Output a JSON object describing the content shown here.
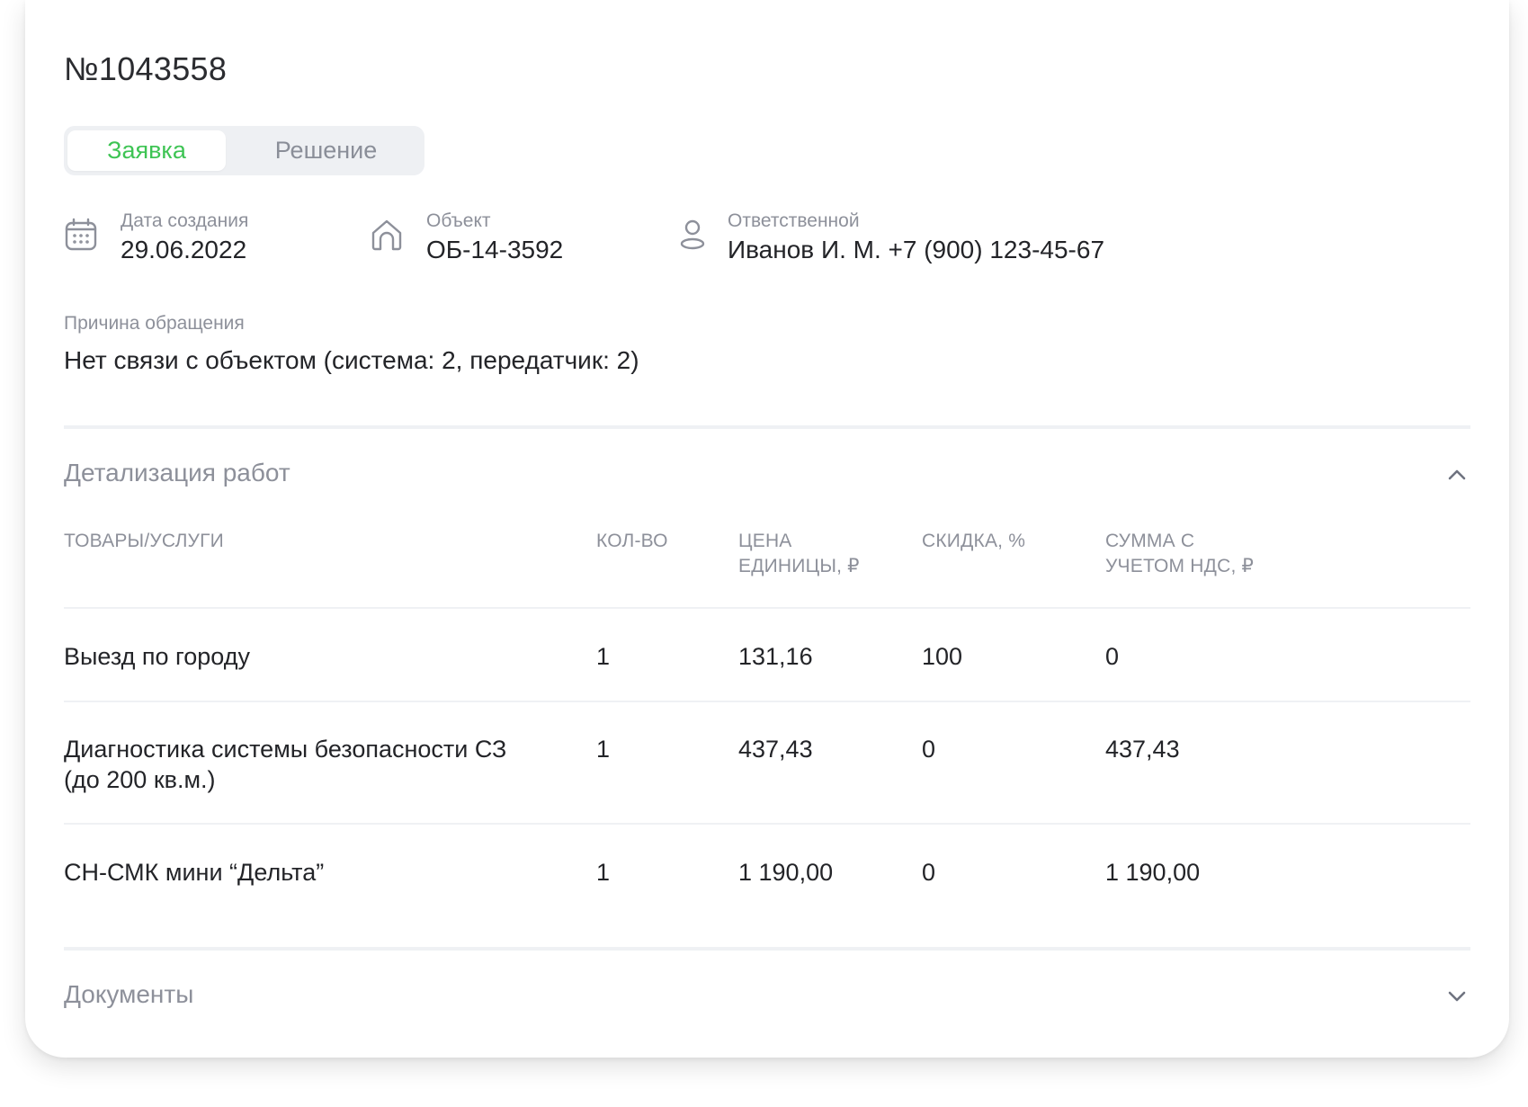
{
  "request": {
    "number": "№1043558",
    "tabs": [
      {
        "label": "Заявка",
        "active": true
      },
      {
        "label": "Решение",
        "active": false
      }
    ],
    "meta": {
      "created": {
        "label": "Дата создания",
        "value": "29.06.2022",
        "icon": "calendar-icon"
      },
      "object": {
        "label": "Объект",
        "value": "ОБ-14-3592",
        "icon": "house-icon"
      },
      "responsible": {
        "label": "Ответственной",
        "value": "Иванов И. М. +7 (900) 123-45-67",
        "icon": "person-icon"
      }
    },
    "reason": {
      "label": "Причина обращения",
      "value": "Нет связи с объектом (система: 2, передатчик: 2)"
    }
  },
  "works": {
    "title": "Детализация работ",
    "expanded": true,
    "columns": {
      "item": "ТОВАРЫ/УСЛУГИ",
      "qty": "КОЛ-ВО",
      "price_l1": "ЦЕНА",
      "price_l2": "ЕДИНИЦЫ, ₽",
      "discount": "СКИДКА, %",
      "total_l1": "СУММА С",
      "total_l2": "УЧЕТОМ НДС, ₽"
    },
    "rows": [
      {
        "item": "Выезд по городу",
        "qty": "1",
        "price": "131,16",
        "discount": "100",
        "total": "0"
      },
      {
        "item_l1": "Диагностика системы безопасности СЗ",
        "item_l2": "(до 200 кв.м.)",
        "qty": "1",
        "price": "437,43",
        "discount": "0",
        "total": "437,43"
      },
      {
        "item": "СН-СМК мини “Дельта”",
        "qty": "1",
        "price": "1 190,00",
        "discount": "0",
        "total": "1 190,00"
      }
    ]
  },
  "documents": {
    "title": "Документы",
    "expanded": false
  },
  "colors": {
    "accent_green": "#3ec454",
    "muted_text": "#8d909a",
    "divider": "#eff1f4"
  }
}
